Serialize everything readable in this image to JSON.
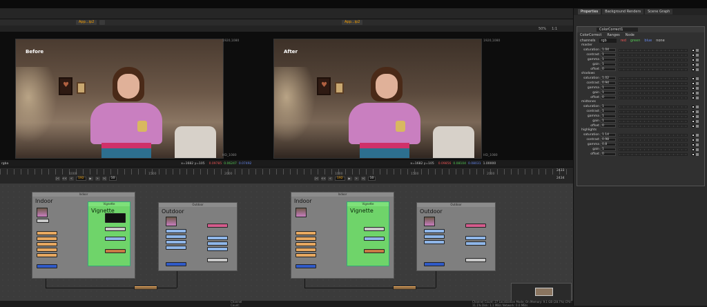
{
  "properties_panel": {
    "tabs": [
      "Properties",
      "Background Renders",
      "Scene Graph"
    ],
    "node_name": "ColorCorrect1",
    "subtabs": [
      "ColorCorrect",
      "Ranges",
      "Node"
    ],
    "channels": {
      "label": "channels",
      "value": "rgb",
      "options": [
        "red",
        "green",
        "blue",
        "none"
      ]
    },
    "sections": [
      {
        "name": "master",
        "rows": [
          {
            "label": "saturation",
            "value": "1.04"
          },
          {
            "label": "contrast",
            "value": "1"
          },
          {
            "label": "gamma",
            "value": "1"
          },
          {
            "label": "gain",
            "value": "1"
          },
          {
            "label": "offset",
            "value": "0"
          }
        ]
      },
      {
        "name": "shadows",
        "rows": [
          {
            "label": "saturation",
            "value": "1.02"
          },
          {
            "label": "contrast",
            "value": "0.94"
          },
          {
            "label": "gamma",
            "value": "1"
          },
          {
            "label": "gain",
            "value": "1"
          },
          {
            "label": "offset",
            "value": "0"
          }
        ]
      },
      {
        "name": "midtones",
        "rows": [
          {
            "label": "saturation",
            "value": "1"
          },
          {
            "label": "contrast",
            "value": "1"
          },
          {
            "label": "gamma",
            "value": "1"
          },
          {
            "label": "gain",
            "value": "1"
          },
          {
            "label": "offset",
            "value": "0"
          }
        ]
      },
      {
        "name": "highlights",
        "rows": [
          {
            "label": "saturation",
            "value": "1.14"
          },
          {
            "label": "contrast",
            "value": "0.98"
          },
          {
            "label": "gamma",
            "value": "0.8"
          },
          {
            "label": "gain",
            "value": "1"
          },
          {
            "label": "offset",
            "value": "0"
          }
        ]
      }
    ]
  },
  "viewers": {
    "tab_label": "App...ip2",
    "tab_label2": "App...ip2",
    "left": {
      "label": "Before",
      "res_top": "1920,1080",
      "res_bottom": "HD_1080",
      "coords": "x=1682 y=105",
      "r": "0.09785",
      "g": "0.06247",
      "b": "0.07492",
      "pixel_prefix": "rgba"
    },
    "right": {
      "label": "After",
      "res_top": "1920,1080",
      "res_bottom": "HD_1080",
      "coords": "x=1682 y=105",
      "r": "0.09856",
      "g": "0.08104",
      "b": "0.08031",
      "a": "1.00000"
    },
    "zoom": "50%",
    "ratio": "1:1",
    "view_mode": "2D"
  },
  "timeline": {
    "left_frame": "192",
    "right_frame": "192",
    "step": "10",
    "end_frame_a": "2433",
    "end_frame_b": "2434",
    "ticks": [
      "1000",
      "1500",
      "2000"
    ]
  },
  "dag": {
    "left": {
      "indoor": "Indoor",
      "vignette": "Vignette",
      "outdoor": "Outdoor",
      "indoor_tag": "Indoor",
      "vignette_tag": "Vignette",
      "outdoor_tag": "Outdoor"
    },
    "right": {
      "indoor": "Indoor",
      "vignette": "Vignette",
      "outdoor": "Outdoor"
    }
  },
  "status": {
    "left": "Channel Count: ",
    "right": "Channel Count: 27  Localization Mode: On  Memory: 9.1 GB (28.7%)  CPU: 11.1%  Disk: 1.1 MB/s  Network: 0.0 MB/s"
  },
  "colors": {
    "accent": "#f6a000",
    "vignette_green": "#6fd46a"
  }
}
